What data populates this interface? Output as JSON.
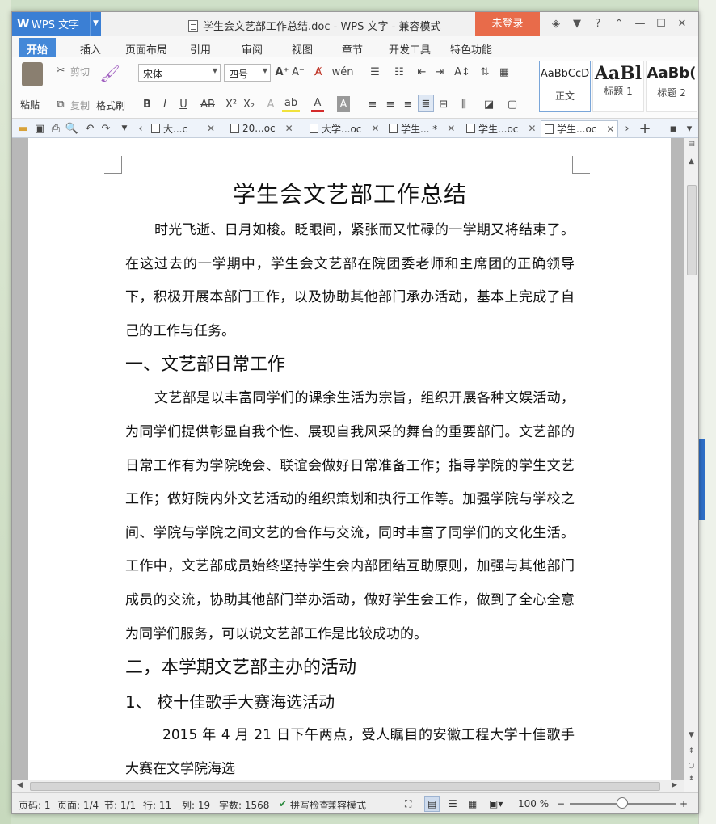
{
  "titlebar": {
    "app_button": "WPS 文字",
    "window_title": "学生会文艺部工作总结.doc - WPS 文字 - 兼容模式",
    "login_button": "未登录"
  },
  "menu": {
    "tabs": [
      "开始",
      "插入",
      "页面布局",
      "引用",
      "审阅",
      "视图",
      "章节",
      "开发工具",
      "特色功能"
    ]
  },
  "ribbon": {
    "paste": "粘贴",
    "cut": "剪切",
    "copy": "复制",
    "format_painter": "格式刷",
    "font_name": "宋体",
    "font_size": "四号",
    "styles": [
      {
        "sample": "AaBbCcD",
        "label": "正文"
      },
      {
        "sample": "AaBl",
        "label": "标题 1"
      },
      {
        "sample": "AaBb(",
        "label": "标题 2"
      }
    ]
  },
  "doc_tabs": [
    {
      "label": "大...c"
    },
    {
      "label": "20...oc"
    },
    {
      "label": "大学...oc"
    },
    {
      "label": "学生... *"
    },
    {
      "label": "学生...oc"
    },
    {
      "label": "学生...oc"
    }
  ],
  "document": {
    "title": "学生会文艺部工作总结",
    "p1": "时光飞逝、日月如梭。眨眼间，紧张而又忙碌的一学期又将结束了。在这过去的一学期中，学生会文艺部在院团委老师和主席团的正确领导下，积极开展本部门工作，以及协助其他部门承办活动，基本上完成了自己的工作与任务。",
    "h1": "一、文艺部日常工作",
    "p2": "文艺部是以丰富同学们的课余生活为宗旨，组织开展各种文娱活动，为同学们提供彰显自我个性、展现自我风采的舞台的重要部门。文艺部的日常工作有为学院晚会、联谊会做好日常准备工作；指导学院的学生文艺工作；做好院内外文艺活动的组织策划和执行工作等。加强学院与学校之间、学院与学院之间文艺的合作与交流，同时丰富了同学们的文化生活。工作中，文艺部成员始终坚持学生会内部团结互助原则，加强与其他部门成员的交流，协助其他部门举办活动，做好学生会工作，做到了全心全意为同学们服务，可以说文艺部工作是比较成功的。",
    "h2": "二，本学期文艺部主办的活动",
    "h3": "1、  校十佳歌手大赛海选活动",
    "p3": "2015 年 4 月 21 日下午两点，受人瞩目的安徽工程大学十佳歌手大赛在文学院海选"
  },
  "status": {
    "page_no": "页码: 1",
    "pages": "页面: 1/4",
    "section": "节: 1/1",
    "row": "行: 11",
    "col": "列: 19",
    "words": "字数: 1568",
    "spell": "拼写检查",
    "compat": "兼容模式",
    "zoom": "100 %"
  },
  "colors": {
    "accent_blue": "#3b7fd4",
    "login_orange": "#e86b4a"
  }
}
